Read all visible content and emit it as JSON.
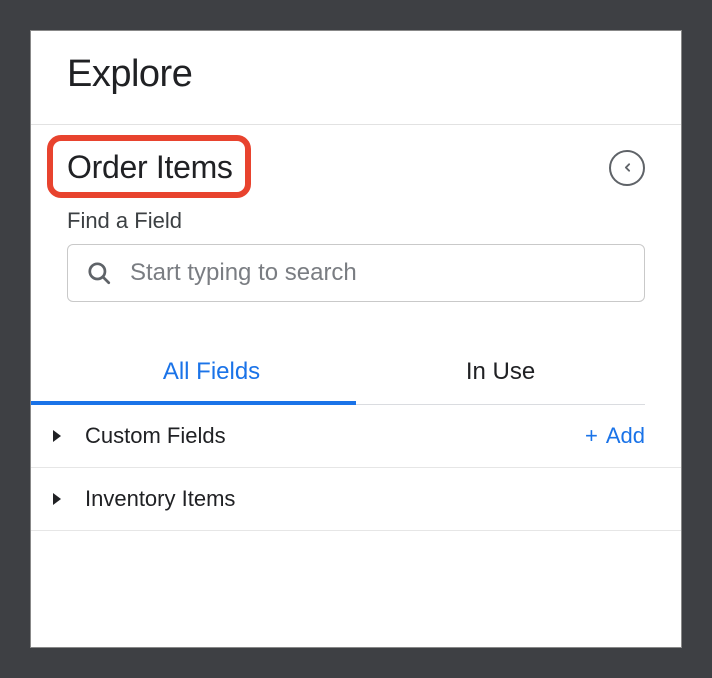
{
  "header": {
    "title": "Explore"
  },
  "section": {
    "title": "Order Items"
  },
  "search": {
    "label": "Find a Field",
    "placeholder": "Start typing to search"
  },
  "tabs": {
    "all_fields": "All Fields",
    "in_use": "In Use"
  },
  "fields": {
    "custom_fields": "Custom Fields",
    "inventory_items": "Inventory Items",
    "add_label": "Add"
  }
}
